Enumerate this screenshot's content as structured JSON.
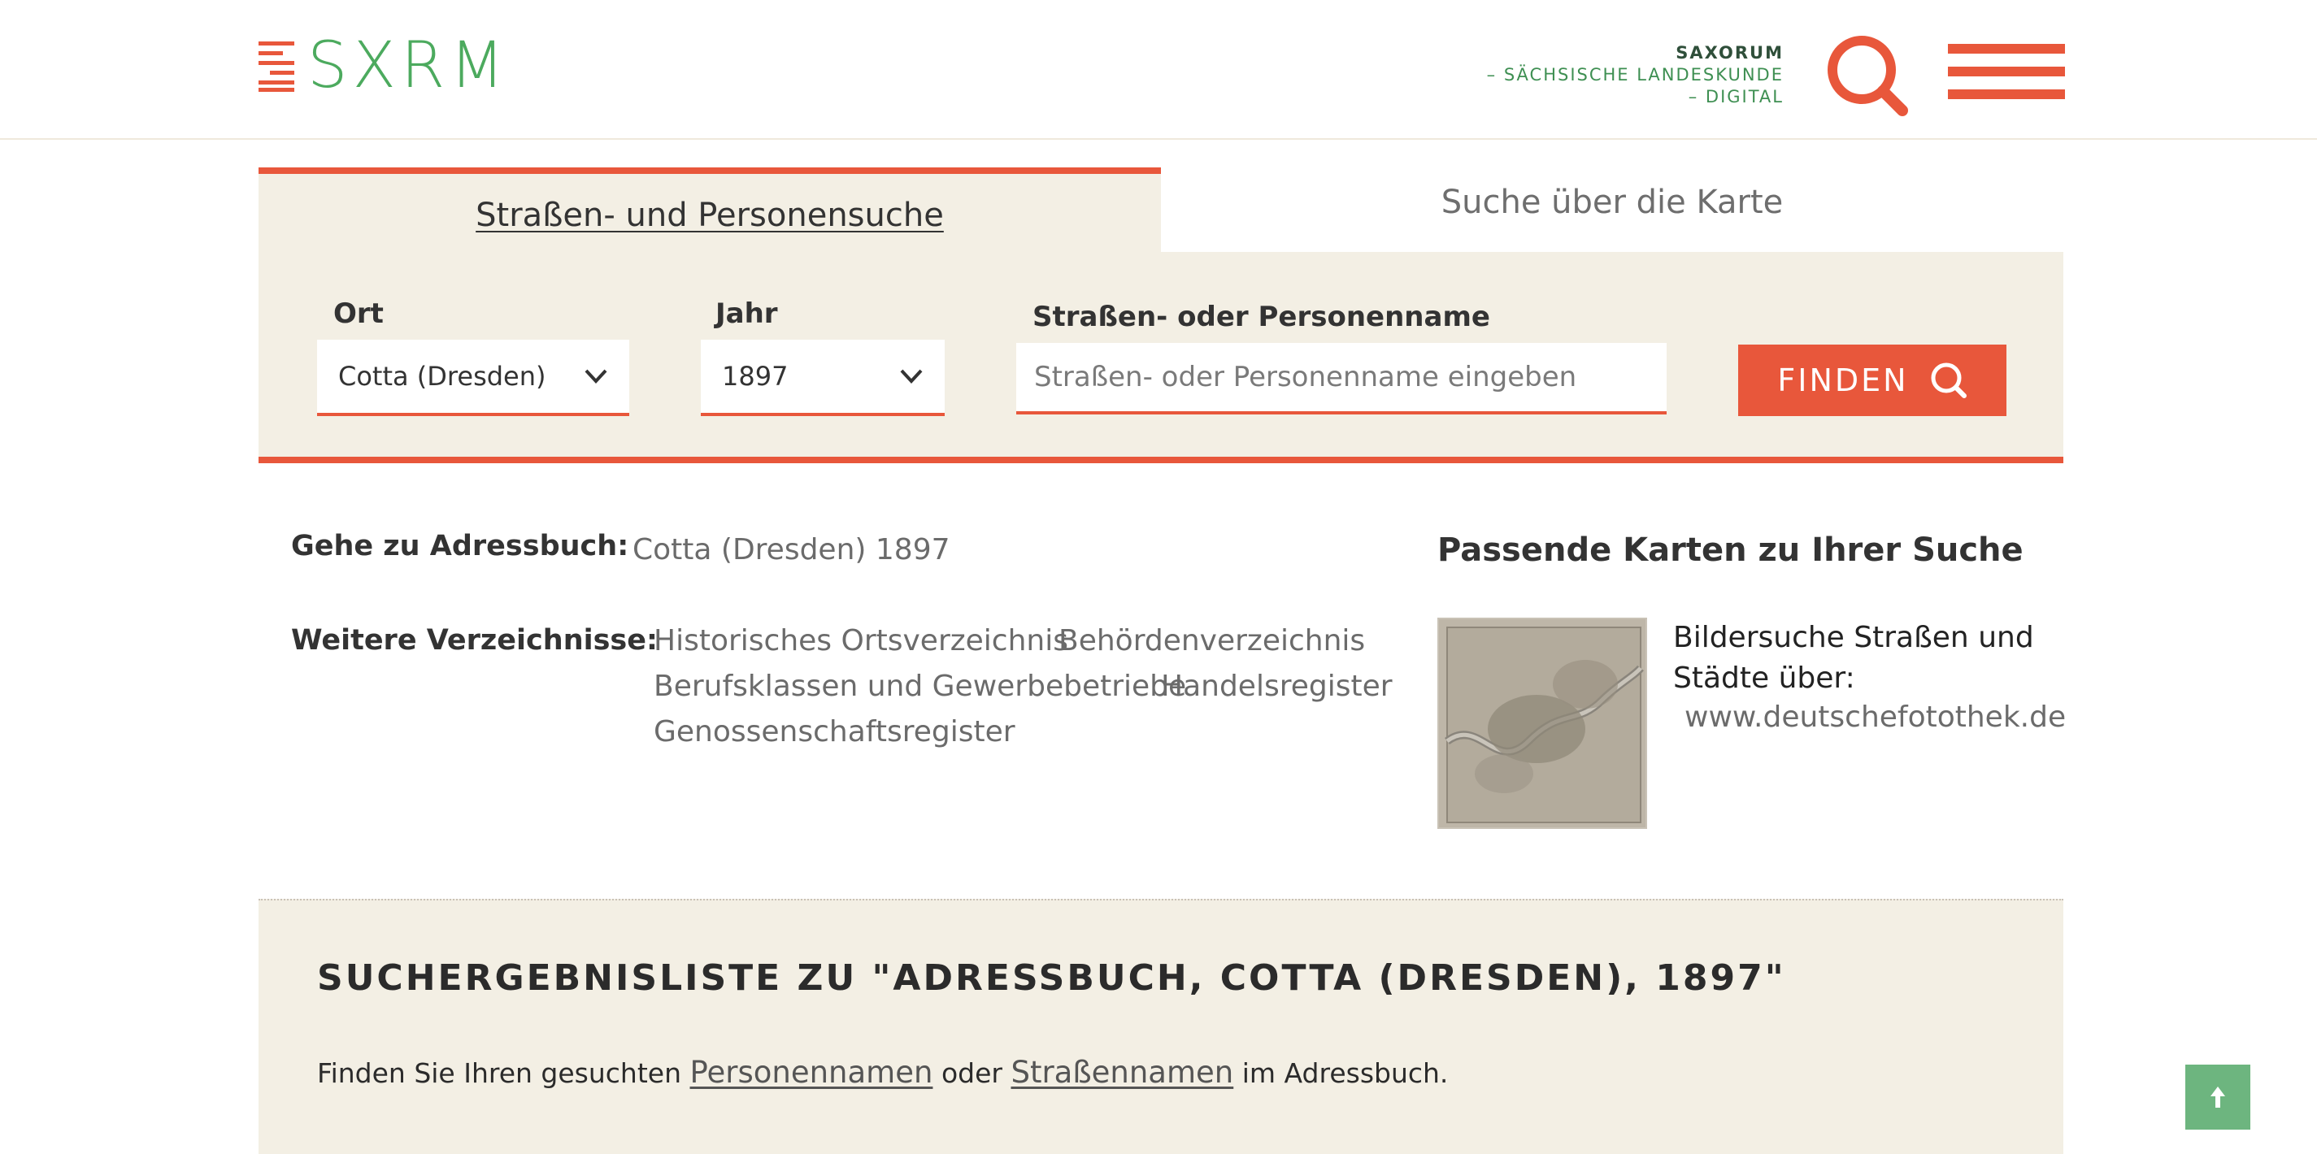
{
  "header": {
    "logo_text": "SXRM",
    "brand_line1": "SAXORUM",
    "brand_line2": "– SÄCHSISCHE LANDESKUNDE",
    "brand_line3": "– DIGITAL",
    "search_icon": "search-icon",
    "menu_icon": "hamburger-menu-icon"
  },
  "tabs": [
    {
      "label": "Straßen- und Personensuche",
      "active": true
    },
    {
      "label": "Suche über die Karte",
      "active": false
    }
  ],
  "search": {
    "ort_label": "Ort",
    "ort_value": "Cotta (Dresden)",
    "jahr_label": "Jahr",
    "jahr_value": "1897",
    "name_label": "Straßen- oder Personenname",
    "name_placeholder": "Straßen- oder Personenname eingeben",
    "name_value": "",
    "find_label": "FINDEN"
  },
  "info": {
    "goto_label": "Gehe zu Adressbuch:",
    "goto_link": "Cotta (Dresden) 1897",
    "more_label": "Weitere Verzeichnisse:",
    "directories": [
      "Historisches Ortsverzeichnis",
      "Behördenverzeichnis",
      "Berufsklassen und Gewerbebetriebe",
      "Handelsregister",
      "Genossenschaftsregister"
    ]
  },
  "maps": {
    "title": "Passende Karten zu Ihrer Suche",
    "caption": "Bildersuche Straßen und Städte über:",
    "link": "www.deutschefotothek.de"
  },
  "results": {
    "title": "SUCHERGEBNISLISTE ZU \"ADRESSBUCH, COTTA (DRESDEN), 1897\"",
    "text_before": "Finden Sie Ihren gesuchten",
    "link_persons": "Personennamen",
    "text_middle": "oder",
    "link_streets": "Straßennamen",
    "text_after": "im Adressbuch."
  },
  "colors": {
    "accent": "#e8573b",
    "brand_green": "#4caa5e",
    "panel_bg": "#f3efe4",
    "to_top_bg": "#6db57f"
  }
}
